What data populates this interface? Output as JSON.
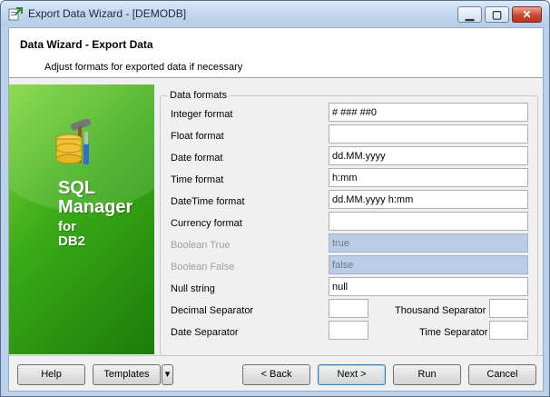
{
  "window": {
    "title": "Export Data Wizard - [DEMODB]",
    "controls": {
      "minimize": "▁",
      "maximize": "▢",
      "close": "✕"
    }
  },
  "header": {
    "title": "Data Wizard - Export Data",
    "subtitle": "Adjust formats for exported data if necessary"
  },
  "banner": {
    "line1": "SQL",
    "line2": "Manager",
    "line3": "for",
    "line4": "DB2",
    "logo_icon": "database-tools-icon",
    "gradient_colors": [
      "#7ed63a",
      "#39a917",
      "#1b7d0a"
    ]
  },
  "formats": {
    "group_title": "Data formats",
    "integer": {
      "label": "Integer format",
      "value": "# ### ##0"
    },
    "float": {
      "label": "Float format",
      "value": ""
    },
    "date": {
      "label": "Date format",
      "value": "dd.MM.yyyy"
    },
    "time": {
      "label": "Time format",
      "value": "h:mm"
    },
    "datetime": {
      "label": "DateTime format",
      "value": "dd.MM.yyyy h:mm"
    },
    "currency": {
      "label": "Currency format",
      "value": ""
    },
    "boolean_true": {
      "label": "Boolean True",
      "value": "true",
      "enabled": false
    },
    "boolean_false": {
      "label": "Boolean False",
      "value": "false",
      "enabled": false
    },
    "null_string": {
      "label": "Null string",
      "value": "null"
    },
    "decimal_sep": {
      "label": "Decimal Separator",
      "value": ""
    },
    "thousand_sep": {
      "label": "Thousand Separator",
      "value": ""
    },
    "date_sep": {
      "label": "Date Separator",
      "value": ""
    },
    "time_sep": {
      "label": "Time Separator",
      "value": ""
    }
  },
  "buttons": {
    "help": "Help",
    "templates": "Templates",
    "templates_dropdown": "▾",
    "back": "< Back",
    "next": "Next >",
    "run": "Run",
    "cancel": "Cancel"
  },
  "colors": {
    "disabled_field": "#b9cde6",
    "titlebar": "#c3d7ef"
  }
}
